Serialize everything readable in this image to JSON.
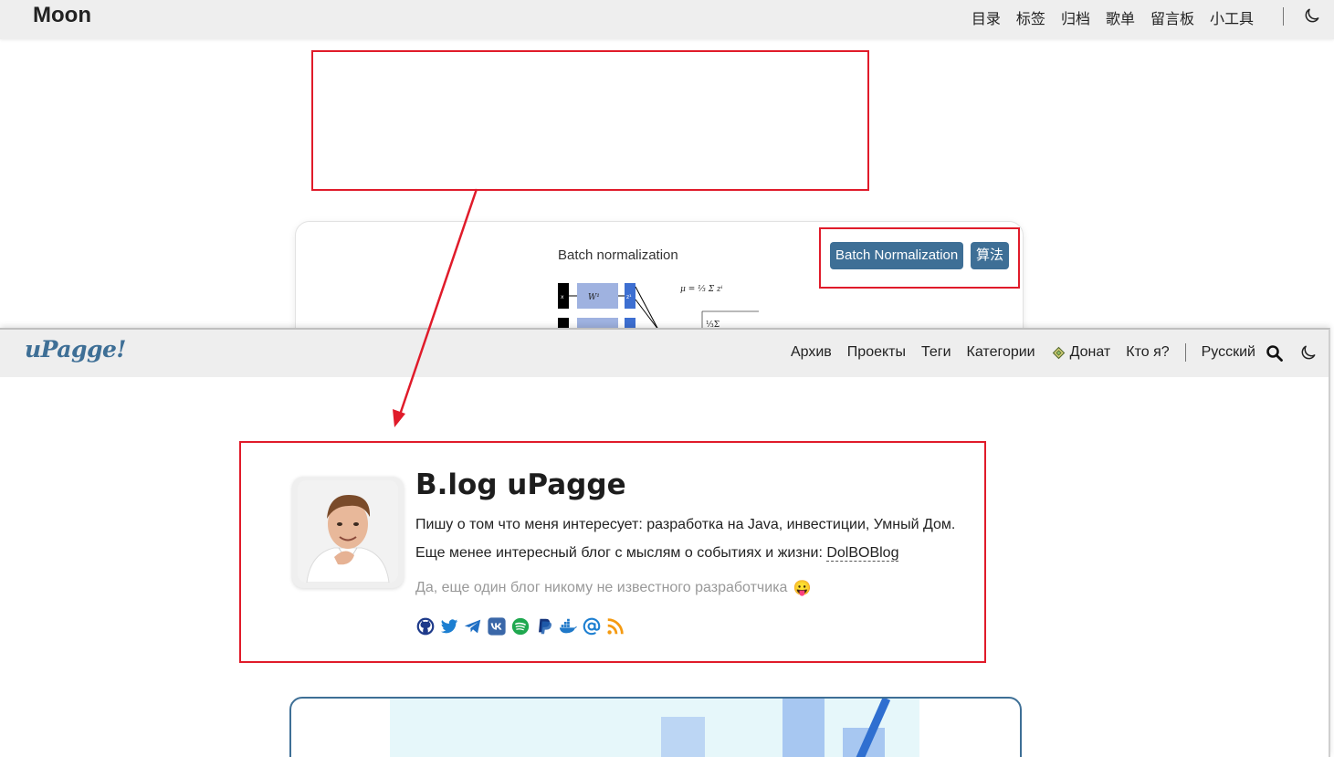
{
  "back_page": {
    "logo": "Moon",
    "nav": [
      "目录",
      "标签",
      "归档",
      "歌单",
      "留言板",
      "小工具"
    ],
    "post": {
      "image_title": "Batch normalization",
      "tags": [
        "Batch Normalization",
        "算法"
      ]
    }
  },
  "front_page": {
    "logo": "uPagge!",
    "nav": {
      "archive": "Архив",
      "projects": "Проекты",
      "tags": "Теги",
      "categories": "Категории",
      "donate": "Донат",
      "about": "Кто я?",
      "language": "Русский"
    },
    "profile": {
      "title": "B.log uPagge",
      "description_pre": "Пишу о том что меня интересует: разработка на Java, инвестиции, Умный Дом. Еще менее интересный блог с мыслям о событиях и жизни: ",
      "description_link": "DolBOBlog",
      "subtitle": "Да, еще один блог никому не известного разработчика",
      "subtitle_emoji": "😛",
      "socials": [
        "github-icon",
        "twitter-icon",
        "telegram-icon",
        "vk-icon",
        "spotify-icon",
        "paypal-icon",
        "docker-icon",
        "email-icon",
        "rss-icon"
      ]
    }
  },
  "colors": {
    "accent": "#3e6f96",
    "annotation_red": "#e01b2a",
    "header_bg": "#eeeeee"
  }
}
